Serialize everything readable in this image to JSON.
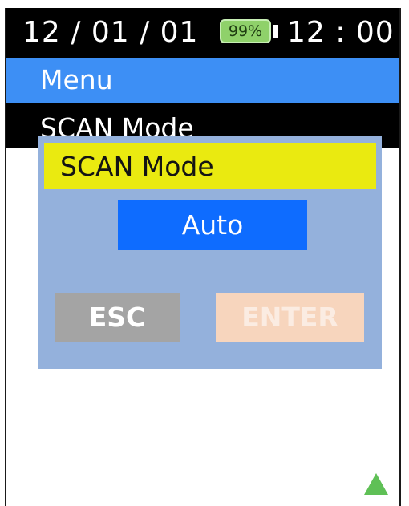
{
  "status_bar": {
    "date": "12 / 01 / 01",
    "battery_level": "99%",
    "time": "12 : 00"
  },
  "menu_bar": {
    "label": "Menu"
  },
  "sub_bar": {
    "label": "SCAN Mode"
  },
  "dialog": {
    "title": "SCAN Mode",
    "selected_value": "Auto",
    "esc_label": "ESC",
    "enter_label": "ENTER"
  },
  "icons": {
    "scroll_indicator": "triangle-up-icon"
  },
  "colors": {
    "status_bar_bg": "#000000",
    "menu_bar_bg": "#3d8ff5",
    "dialog_bg": "#94b1dc",
    "dialog_title_bg": "#eaea10",
    "selected_value_bg": "#0e6cff",
    "esc_button_bg": "#a4a4a4",
    "enter_button_bg": "#f7d5bd",
    "battery_fill": "#8fd16a",
    "indicator": "#5fc056"
  }
}
